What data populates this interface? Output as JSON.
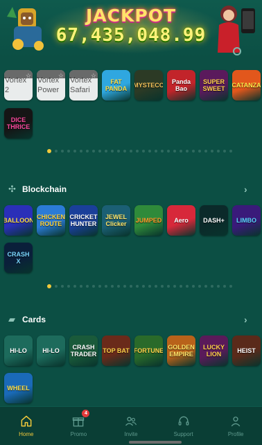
{
  "jackpot": {
    "title": "JACKPOT",
    "amount": "67,435,048.99"
  },
  "colors": {
    "background": "#0c4f44",
    "accent": "#f1c93b",
    "nav_inactive": "#5f9a8e"
  },
  "top_games": {
    "tiles": [
      {
        "label": "Vortex 2",
        "style": "placeholder"
      },
      {
        "label": "Vortex Power",
        "style": "placeholder"
      },
      {
        "label": "Vortex Safari",
        "style": "placeholder"
      },
      {
        "label": "FAT PANDA",
        "style": "art",
        "bg": "#2fa7e0",
        "fg": "#ffe14a"
      },
      {
        "label": "MYSTECO",
        "style": "art",
        "bg": "#2c3a25",
        "fg": "#f3c15a"
      },
      {
        "label": "Panda Bao",
        "style": "art",
        "bg": "#c2242a",
        "fg": "#ffffff"
      },
      {
        "label": "SUPER SWEET",
        "style": "art",
        "bg": "#5a1a5c",
        "fg": "#ffd24a"
      },
      {
        "label": "CATANZA",
        "style": "art",
        "bg": "#e2571c",
        "fg": "#ffea4a"
      }
    ],
    "tiles_row2": [
      {
        "label": "DICE THRICE",
        "style": "art",
        "bg": "#151515",
        "fg": "#ff4aa0"
      }
    ],
    "pager_count": 30,
    "pager_active": 0
  },
  "blockchain": {
    "title": "Blockchain",
    "icon": "blockchain-icon",
    "tiles": [
      {
        "label": "BALLOON",
        "style": "art",
        "bg": "#2a2fb8",
        "fg": "#ffe14a"
      },
      {
        "label": "CHICKEN ROUTE",
        "style": "art",
        "bg": "#2b7bd6",
        "fg": "#ffd43a"
      },
      {
        "label": "CRICKET HUNTER",
        "style": "art",
        "bg": "#1a3f9a",
        "fg": "#ffffff"
      },
      {
        "label": "JEWEL Clicker",
        "style": "art",
        "bg": "#1b5f74",
        "fg": "#ffe66a"
      },
      {
        "label": "JUMPED",
        "style": "art",
        "bg": "#2f8a3a",
        "fg": "#ff9a2a"
      },
      {
        "label": "Aero",
        "style": "art",
        "bg": "#d7283a",
        "fg": "#ffffff"
      },
      {
        "label": "DASH+",
        "style": "art",
        "bg": "#0b2a2a",
        "fg": "#ffffff"
      },
      {
        "label": "LIMBO",
        "style": "art",
        "bg": "#3a1a7a",
        "fg": "#5ad7ff"
      }
    ],
    "tiles_row2": [
      {
        "label": "CRASH X",
        "style": "art",
        "bg": "#0a1f3a",
        "fg": "#7ad7ff"
      }
    ],
    "pager_count": 30,
    "pager_active": 0
  },
  "cards": {
    "title": "Cards",
    "icon": "cards-icon",
    "tiles": [
      {
        "label": "HI-LO",
        "style": "art",
        "bg": "#1d6b5c",
        "fg": "#ffffff"
      },
      {
        "label": "HI-LO",
        "style": "art",
        "bg": "#1d6b5c",
        "fg": "#ffffff"
      },
      {
        "label": "CRASH TRADER",
        "style": "art",
        "bg": "#1a5a3a",
        "fg": "#ffffff"
      },
      {
        "label": "TOP BAT",
        "style": "art",
        "bg": "#6a2a1a",
        "fg": "#ffd24a"
      },
      {
        "label": "FORTUNE",
        "style": "art",
        "bg": "#2a6a2a",
        "fg": "#ffd24a"
      },
      {
        "label": "GOLDEN EMPIRE",
        "style": "art",
        "bg": "#b8621a",
        "fg": "#ffe66a"
      },
      {
        "label": "LUCKY LION",
        "style": "art",
        "bg": "#5a1a5a",
        "fg": "#ffd24a"
      },
      {
        "label": "HEIST",
        "style": "art",
        "bg": "#5a2a1a",
        "fg": "#ffffff"
      }
    ],
    "tiles_row2": [
      {
        "label": "WHEEL",
        "style": "art",
        "bg": "#1a6ab8",
        "fg": "#ffe14a"
      }
    ]
  },
  "nav": {
    "items": [
      {
        "label": "Home",
        "icon": "home-icon",
        "active": true
      },
      {
        "label": "Promo",
        "icon": "gift-icon",
        "badge": "4"
      },
      {
        "label": "Invite",
        "icon": "users-icon"
      },
      {
        "label": "Support",
        "icon": "headset-icon"
      },
      {
        "label": "Profile",
        "icon": "user-icon"
      }
    ]
  }
}
